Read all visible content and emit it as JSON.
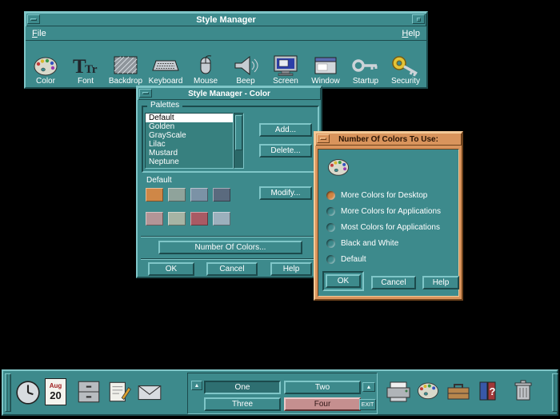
{
  "colors": {
    "desktop_bg": "#000000",
    "teal": "#3d8a8c",
    "teal_pressed": "#2e6f71",
    "teal_highlight": "#7fc6c8",
    "teal_shadow": "#1c4a4c",
    "active_orange": "#d9945c",
    "selected_radio": "#d08440",
    "rose_workspace": "#c58f8f"
  },
  "icons": {
    "up_arrow": "▲",
    "names": [
      "clock-icon",
      "calendar-icon",
      "file-manager-icon",
      "text-editor-icon",
      "mail-icon",
      "printer-icon",
      "style-manager-icon",
      "applications-icon",
      "help-icon",
      "trash-icon"
    ]
  },
  "main_window": {
    "title": "Style Manager",
    "menu": {
      "file": "File",
      "help": "Help"
    },
    "tools": [
      {
        "name": "color-palette",
        "label": "Color"
      },
      {
        "name": "font-letters",
        "label": "Font"
      },
      {
        "name": "backdrop-pattern",
        "label": "Backdrop"
      },
      {
        "name": "keyboard",
        "label": "Keyboard"
      },
      {
        "name": "mouse",
        "label": "Mouse"
      },
      {
        "name": "beep-horn",
        "label": "Beep"
      },
      {
        "name": "screen-monitor",
        "label": "Screen"
      },
      {
        "name": "window-frame",
        "label": "Window"
      },
      {
        "name": "startup-key",
        "label": "Startup"
      },
      {
        "name": "security-key",
        "label": "Security"
      }
    ]
  },
  "color_dialog": {
    "title": "Style Manager - Color",
    "palettes_label": "Palettes",
    "palette_items": [
      "Default",
      "Golden",
      "GrayScale",
      "Lilac",
      "Mustard",
      "Neptune"
    ],
    "selected_palette": "Default",
    "palette_preview_label": "Default",
    "swatches": [
      "#cf8747",
      "#8fa39b",
      "#7b92a6",
      "#5a6a7e",
      "#b39597",
      "#a6b4a4",
      "#a95a64",
      "#9cb0bd"
    ],
    "buttons": {
      "add": "Add...",
      "delete": "Delete...",
      "modify": "Modify...",
      "number_of_colors": "Number Of Colors...",
      "ok": "OK",
      "cancel": "Cancel",
      "help": "Help"
    }
  },
  "num_colors_dialog": {
    "title": "Number Of Colors To Use:",
    "options": [
      "More Colors for Desktop",
      "More Colors for Applications",
      "Most Colors for Applications",
      "Black and White",
      "Default"
    ],
    "selected_index": 0,
    "buttons": {
      "ok": "OK",
      "cancel": "Cancel",
      "help": "Help"
    }
  },
  "panel": {
    "calendar": {
      "month": "Aug",
      "day": "20"
    },
    "workspaces": [
      "One",
      "Two",
      "Three",
      "Four"
    ],
    "active_workspace": "One",
    "exit_label": "EXIT"
  }
}
